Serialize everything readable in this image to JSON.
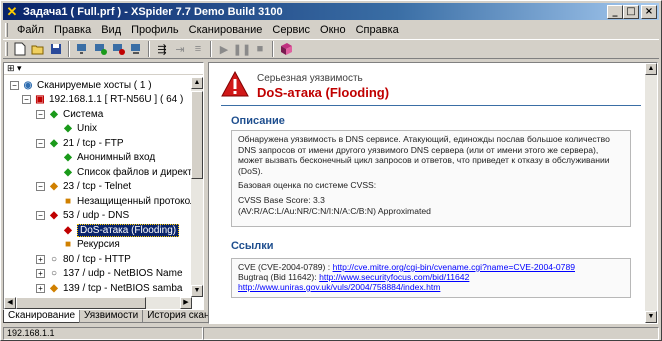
{
  "window": {
    "title": "Задача1 ( Full.prf ) - XSpider 7.7 Demo Build 3100",
    "min": "_",
    "max": "□",
    "close": "×"
  },
  "menu": {
    "items": [
      {
        "label": "Файл"
      },
      {
        "label": "Правка"
      },
      {
        "label": "Вид"
      },
      {
        "label": "Профиль"
      },
      {
        "label": "Сканирование"
      },
      {
        "label": "Сервис"
      },
      {
        "label": "Окно"
      },
      {
        "label": "Справка"
      }
    ]
  },
  "tree": {
    "header": "⊞ ▾",
    "nodes": [
      {
        "label": "Сканируемые хосты ( 1 )",
        "icon": "globe-icon",
        "glyph": "◉",
        "color": "#2e6db0",
        "depth": 0,
        "exp": "−"
      },
      {
        "label": "192.168.1.1 [ RT-N56U ] ( 64 )",
        "icon": "host-alert-icon",
        "glyph": "▣",
        "color": "#c00000",
        "depth": 1,
        "exp": "−"
      },
      {
        "label": "Система",
        "icon": "system-icon",
        "glyph": "◆",
        "color": "#1a9a1a",
        "depth": 2,
        "exp": "−"
      },
      {
        "label": "Unix",
        "icon": "info-icon",
        "glyph": "◆",
        "color": "#1a9a1a",
        "depth": 3,
        "exp": ""
      },
      {
        "label": "21 / tcp - FTP",
        "icon": "port-icon",
        "glyph": "◆",
        "color": "#1a9a1a",
        "depth": 2,
        "exp": "−"
      },
      {
        "label": "Анонимный вход",
        "icon": "info-icon",
        "glyph": "◆",
        "color": "#1a9a1a",
        "depth": 3,
        "exp": ""
      },
      {
        "label": "Список файлов и директори",
        "icon": "info-icon",
        "glyph": "◆",
        "color": "#1a9a1a",
        "depth": 3,
        "exp": ""
      },
      {
        "label": "23 / tcp - Telnet",
        "icon": "port-warning-icon",
        "glyph": "◆",
        "color": "#d08000",
        "depth": 2,
        "exp": "−"
      },
      {
        "label": "Незащищенный протокол",
        "icon": "warning-square-icon",
        "glyph": "■",
        "color": "#d08000",
        "depth": 3,
        "exp": ""
      },
      {
        "label": "53 / udp - DNS",
        "icon": "port-alert-icon",
        "glyph": "◆",
        "color": "#c00000",
        "depth": 2,
        "exp": "−"
      },
      {
        "label": "DoS-атака (Flooding)",
        "icon": "vuln-icon",
        "glyph": "◆",
        "color": "#c00000",
        "depth": 3,
        "exp": "",
        "selected": true
      },
      {
        "label": "Рекурсия",
        "icon": "warning-square-icon",
        "glyph": "■",
        "color": "#d08000",
        "depth": 3,
        "exp": ""
      },
      {
        "label": "80 / tcp - HTTP",
        "icon": "port-icon",
        "glyph": "○",
        "color": "#404040",
        "depth": 2,
        "exp": "+"
      },
      {
        "label": "137 / udp - NetBIOS Name",
        "icon": "port-icon",
        "glyph": "○",
        "color": "#404040",
        "depth": 2,
        "exp": "+"
      },
      {
        "label": "139 / tcp - NetBIOS samba",
        "icon": "port-warning-icon",
        "glyph": "◆",
        "color": "#d08000",
        "depth": 2,
        "exp": "+"
      },
      {
        "label": "445 / tcp - Microsoft DS",
        "icon": "port-warning-icon",
        "glyph": "◆",
        "color": "#d08000",
        "depth": 2,
        "exp": "+"
      }
    ]
  },
  "tabs": [
    {
      "label": "Сканирование",
      "active": true
    },
    {
      "label": "Уязвимости",
      "active": false
    },
    {
      "label": "История сканирований",
      "active": false
    }
  ],
  "detail": {
    "severity": "Серьезная уязвимость",
    "title": "DoS-атака (Flooding)",
    "desc_heading": "Описание",
    "desc_text": "Обнаружена уязвимость в DNS сервисе. Атакующий, единожды послав большое количество DNS запросов от имени другого уязвимого DNS сервера (или от имени этого же сервера), может вызвать бесконечный цикл запросов и ответов, что приведет к отказу в обслуживании (DoS).",
    "cvss_label": "Базовая оценка по системе CVSS:",
    "cvss_score": "CVSS Base Score: 3.3",
    "cvss_vector": "(AV:R/AC:L/Au:NR/C:N/I:N/A:C/B:N) Approximated",
    "links_heading": "Ссылки",
    "links": [
      {
        "prefix": "CVE (CVE-2004-0789) : ",
        "url": "http://cve.mitre.org/cgi-bin/cvename.cgi?name=CVE-2004-0789"
      },
      {
        "prefix": "Bugtraq (Bid 11642): ",
        "url": "http://www.securityfocus.com/bid/11642"
      },
      {
        "prefix": "",
        "url": "http://www.uniras.gov.uk/vuls/2004/758884/index.htm"
      }
    ]
  },
  "status": {
    "ip": "192.168.1.1"
  }
}
